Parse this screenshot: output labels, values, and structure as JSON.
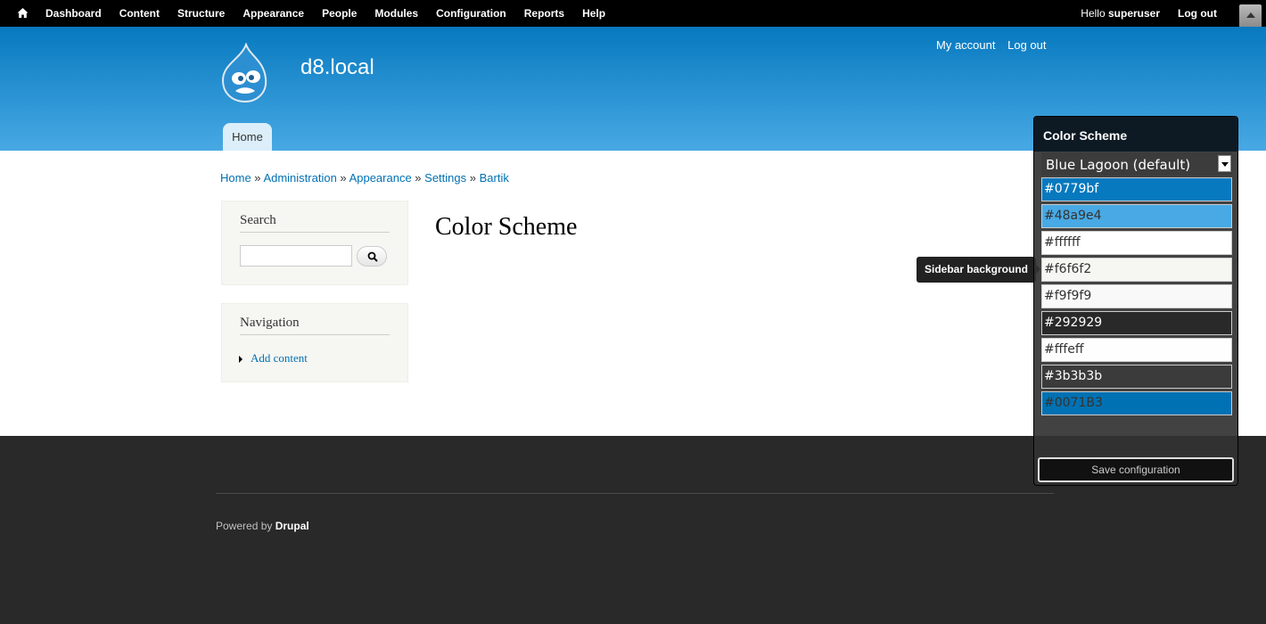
{
  "toolbar": {
    "menu": [
      "Dashboard",
      "Content",
      "Structure",
      "Appearance",
      "People",
      "Modules",
      "Configuration",
      "Reports",
      "Help"
    ],
    "hello_prefix": "Hello ",
    "username": "superuser",
    "logout": "Log out"
  },
  "header": {
    "site_name": "d8.local",
    "my_account": "My account",
    "log_out": "Log out",
    "tab_home": "Home"
  },
  "breadcrumb": [
    "Home",
    "Administration",
    "Appearance",
    "Settings",
    "Bartik"
  ],
  "breadcrumb_separator": " » ",
  "search_block": {
    "title": "Search"
  },
  "navigation_block": {
    "title": "Navigation",
    "link": "Add content"
  },
  "main": {
    "page_title": "Color Scheme"
  },
  "footer": {
    "powered_by": "Powered by ",
    "drupal": "Drupal"
  },
  "color_panel": {
    "title": "Color Scheme",
    "scheme": "Blue Lagoon (default)",
    "swatches": [
      "#0779bf",
      "#48a9e4",
      "#ffffff",
      "#f6f6f2",
      "#f9f9f9",
      "#292929",
      "#fffeff",
      "#3b3b3b",
      "#0071B3"
    ],
    "save_label": "Save configuration"
  },
  "tooltip": "Sidebar background"
}
